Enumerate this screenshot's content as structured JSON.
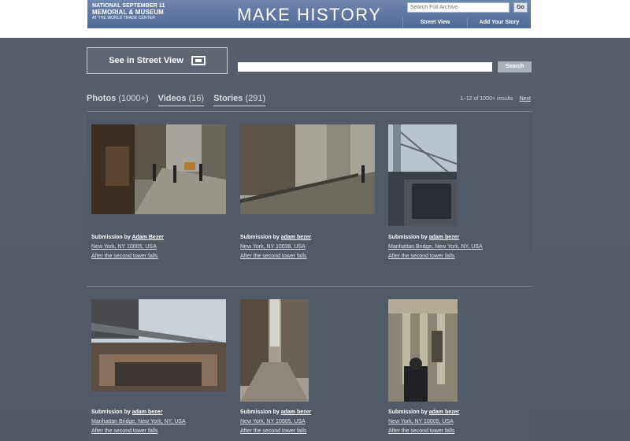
{
  "header": {
    "logo_line1": "NATIONAL SEPTEMBER 11",
    "logo_line2": "MEMORIAL & MUSEUM",
    "logo_line3": "AT THE WORLD TRADE CENTER",
    "title": "MAKE HISTORY",
    "archive_placeholder": "Search Full Archive",
    "go_label": "Go",
    "links": [
      "Street View",
      "Add Your Story"
    ]
  },
  "street_view_label": "See in Street View",
  "search": {
    "placeholder": "",
    "button_label": "Search"
  },
  "tabs": [
    {
      "label": "Photos",
      "count": "(1000+)"
    },
    {
      "label": "Videos",
      "count": "(16)"
    },
    {
      "label": "Stories",
      "count": "(291)"
    }
  ],
  "results": {
    "text": "1–12 of 1000+ results",
    "next_label": "Next"
  },
  "submissions": [
    {
      "prefix": "Submission by",
      "author": "Adam Bezer",
      "location": "New York, NY 10005, USA",
      "title": "After the second tower falls"
    },
    {
      "prefix": "Submission by",
      "author": "adam bezer",
      "location": "New York, NY 10038, USA",
      "title": "After the second tower falls"
    },
    {
      "prefix": "Submission by",
      "author": "adam bezer",
      "location": "Manhattan Bridge, New York, NY, USA",
      "title": "After the second tower falls"
    },
    {
      "prefix": "Submission by",
      "author": "adam bezer",
      "location": "Manhattan Bridge, New York, NY, USA",
      "title": "After the second tower falls"
    },
    {
      "prefix": "Submission by",
      "author": "adam bezer",
      "location": "New York, NY 10005, USA",
      "title": "After the second tower falls"
    },
    {
      "prefix": "Submission by",
      "author": "adam bezer",
      "location": "New York, NY 10005, USA",
      "title": "After the second tower falls"
    }
  ],
  "colors": {
    "background": "#555c69",
    "header_blue": "#5a74a2",
    "text": "#ffffff"
  }
}
